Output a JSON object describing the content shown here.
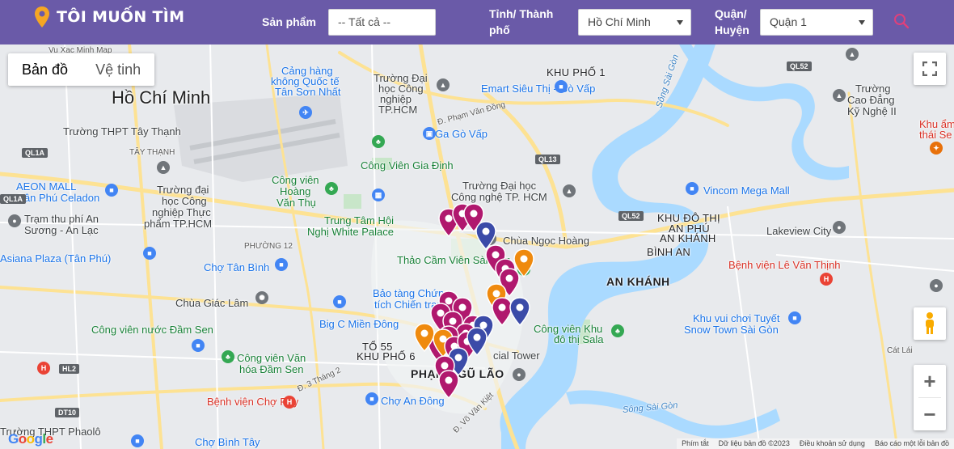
{
  "header": {
    "title": "TÔI MUỐN TÌM",
    "product_label": "Sản phẩm",
    "product_value": "-- Tất cả --",
    "city_label": "Tỉnh/ Thành phố",
    "city_value": "Hồ Chí Minh",
    "district_label": "Quận/ Huyện",
    "district_value": "Quận 1",
    "icons": [
      "location-pin-icon",
      "search-icon",
      "caret-down-icon"
    ],
    "colors": {
      "bar": "#6a5aa8",
      "pin": "#f5a623",
      "search": "#e0407a"
    }
  },
  "map": {
    "type_buttons": [
      "Bản đồ",
      "Vệ tinh"
    ],
    "active_type": "Bản đồ",
    "zoom_in": "+",
    "zoom_out": "−",
    "google_logo": "Google",
    "attribution": [
      "Phím tắt",
      "Dữ liệu bản đồ ©2023",
      "Điều khoản sử dụng",
      "Báo cáo một lỗi bản đồ"
    ],
    "labels": [
      {
        "text": "Hồ Chí Minh",
        "cls": "big"
      },
      {
        "text": "Vu Xac Minh Map",
        "cls": "sm"
      },
      {
        "text": "Cảng hàng",
        "cls": "blue"
      },
      {
        "text": "không Quốc tế",
        "cls": "blue"
      },
      {
        "text": "Tân Sơn Nhất",
        "cls": "blue"
      },
      {
        "text": "Trường Đại",
        "cls": ""
      },
      {
        "text": "học Công",
        "cls": ""
      },
      {
        "text": "nghiệp",
        "cls": ""
      },
      {
        "text": "TP.HCM",
        "cls": ""
      },
      {
        "text": "Emart Siêu Thị - Gò Vấp",
        "cls": "blue"
      },
      {
        "text": "KHU PHỐ 1",
        "cls": "district"
      },
      {
        "text": "Sông Sài Gòn",
        "cls": "water"
      },
      {
        "text": "Trường",
        "cls": ""
      },
      {
        "text": "Cao Đẳng",
        "cls": ""
      },
      {
        "text": "Kỹ Nghệ II",
        "cls": ""
      },
      {
        "text": "Khu ẩm",
        "cls": "red"
      },
      {
        "text": "thái Se",
        "cls": "red"
      },
      {
        "text": "Trường THPT Tây Thạnh",
        "cls": ""
      },
      {
        "text": "TÂY THẠNH",
        "cls": "sm"
      },
      {
        "text": "Đ. Phạm Văn Đồng",
        "cls": "sm"
      },
      {
        "text": "Ga Gò Vấp",
        "cls": "blue"
      },
      {
        "text": "Công Viên Gia Định",
        "cls": "green"
      },
      {
        "text": "AEON MALL",
        "cls": "blue"
      },
      {
        "text": "Tân Phú Celadon",
        "cls": "blue"
      },
      {
        "text": "Trường đại",
        "cls": ""
      },
      {
        "text": "học Công",
        "cls": ""
      },
      {
        "text": "nghiệp Thực",
        "cls": ""
      },
      {
        "text": "phẩm TP.HCM",
        "cls": ""
      },
      {
        "text": "Công viên",
        "cls": "green"
      },
      {
        "text": "Hoàng",
        "cls": "green"
      },
      {
        "text": "Văn Thụ",
        "cls": "green"
      },
      {
        "text": "Trường Đại học",
        "cls": ""
      },
      {
        "text": "Công nghệ TP. HCM",
        "cls": ""
      },
      {
        "text": "Vincom Mega Mall",
        "cls": "blue"
      },
      {
        "text": "KHU ĐÔ THỊ",
        "cls": "district"
      },
      {
        "text": "AN PHÚ",
        "cls": "district"
      },
      {
        "text": "AN KHÁNH",
        "cls": "district"
      },
      {
        "text": "Lakeview City",
        "cls": ""
      },
      {
        "text": "Trạm thu phí An",
        "cls": ""
      },
      {
        "text": "Sương - An Lạc",
        "cls": ""
      },
      {
        "text": "Trung Tâm Hội",
        "cls": "green"
      },
      {
        "text": "Nghị White Palace",
        "cls": "green"
      },
      {
        "text": "Chùa Ngọc Hoàng",
        "cls": ""
      },
      {
        "text": "BÌNH AN",
        "cls": "district"
      },
      {
        "text": "Asiana Plaza (Tân Phú)",
        "cls": "blue"
      },
      {
        "text": "PHƯỜNG 12",
        "cls": "sm"
      },
      {
        "text": "Chợ Tân Bình",
        "cls": "blue"
      },
      {
        "text": "Thảo Cầm Viên Sài Gòn",
        "cls": "green"
      },
      {
        "text": "Bệnh viện Lê Văn Thịnh",
        "cls": "red"
      },
      {
        "text": "AN KHÁNH",
        "cls": "district-b"
      },
      {
        "text": "Bảo tàng Chứng",
        "cls": "blue"
      },
      {
        "text": "tích Chiến tranh",
        "cls": "blue"
      },
      {
        "text": "Chùa Giác Lâm",
        "cls": ""
      },
      {
        "text": "Big C Miền Đông",
        "cls": "blue"
      },
      {
        "text": "Công viên nước Đầm Sen",
        "cls": "green"
      },
      {
        "text": "Công viên Khu",
        "cls": "green"
      },
      {
        "text": "đô thị Sala",
        "cls": "green"
      },
      {
        "text": "Khu vui chơi Tuyết",
        "cls": "blue"
      },
      {
        "text": "Snow Town Sài Gòn",
        "cls": "blue"
      },
      {
        "text": "Công viên Văn",
        "cls": "green"
      },
      {
        "text": "hóa Đầm Sen",
        "cls": "green"
      },
      {
        "text": "TỔ 55",
        "cls": "district"
      },
      {
        "text": "KHU PHỐ 6",
        "cls": "district"
      },
      {
        "text": "PHẠM NGŨ LÃO",
        "cls": "district-b"
      },
      {
        "text": "cial Tower",
        "cls": ""
      },
      {
        "text": "Bệnh viện Chợ Rẫy",
        "cls": "red"
      },
      {
        "text": "Chợ An Đông",
        "cls": "blue"
      },
      {
        "text": "Chợ Bình Tây",
        "cls": "blue"
      },
      {
        "text": "Trường THPT Phaolô",
        "cls": ""
      },
      {
        "text": "Đ. Võ Văn Kiệt",
        "cls": "sm"
      },
      {
        "text": "Sông Sài Gòn",
        "cls": "water"
      },
      {
        "text": "Đ. 3 Tháng 2",
        "cls": "sm"
      },
      {
        "text": "Cát Lái",
        "cls": "sm"
      }
    ]
  }
}
